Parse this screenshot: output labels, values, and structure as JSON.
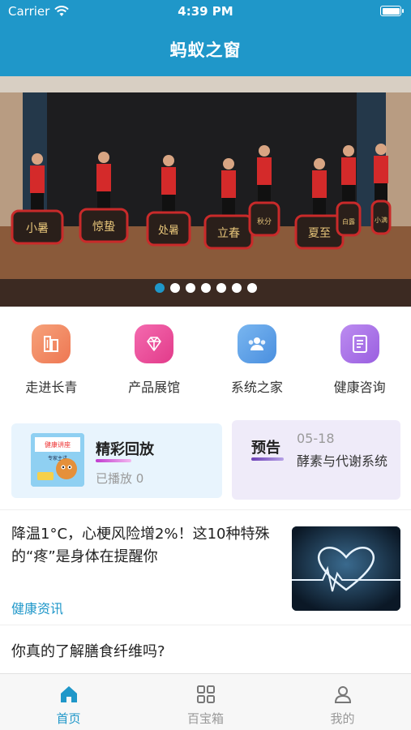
{
  "status": {
    "carrier": "Carrier",
    "time": "4:39 PM"
  },
  "navbar": {
    "title": "蚂蚁之窗"
  },
  "banner": {
    "slide_count": 7,
    "active_index": 0,
    "drum_labels": [
      "小暑",
      "惊蛰",
      "处暑",
      "立春",
      "秋分",
      "夏至",
      "白露",
      "小满"
    ]
  },
  "grid": [
    {
      "label": "走进长青",
      "icon": "building-icon",
      "color": "#f08a5d"
    },
    {
      "label": "产品展馆",
      "icon": "gem-icon",
      "color": "#ec4d98"
    },
    {
      "label": "系统之家",
      "icon": "users-icon",
      "color": "#4a90e2"
    },
    {
      "label": "健康咨询",
      "icon": "document-icon",
      "color": "#a46be0"
    }
  ],
  "replay": {
    "title": "精彩回放",
    "subtitle": "已播放 0",
    "thumb_caption": "健康讲座",
    "thumb_sub": "专家主讲"
  },
  "preview": {
    "tag": "预告",
    "date": "05-18",
    "text": "酵素与代谢系统"
  },
  "news": [
    {
      "title": "降温1°C，心梗风险增2%！这10种特殊的“疼”是身体在提醒你",
      "category": "健康资讯"
    },
    {
      "title": "你真的了解膳食纤维吗?"
    }
  ],
  "tabs": [
    {
      "label": "首页",
      "icon": "home-icon",
      "active": true
    },
    {
      "label": "百宝箱",
      "icon": "grid-icon",
      "active": false
    },
    {
      "label": "我的",
      "icon": "user-icon",
      "active": false
    }
  ]
}
